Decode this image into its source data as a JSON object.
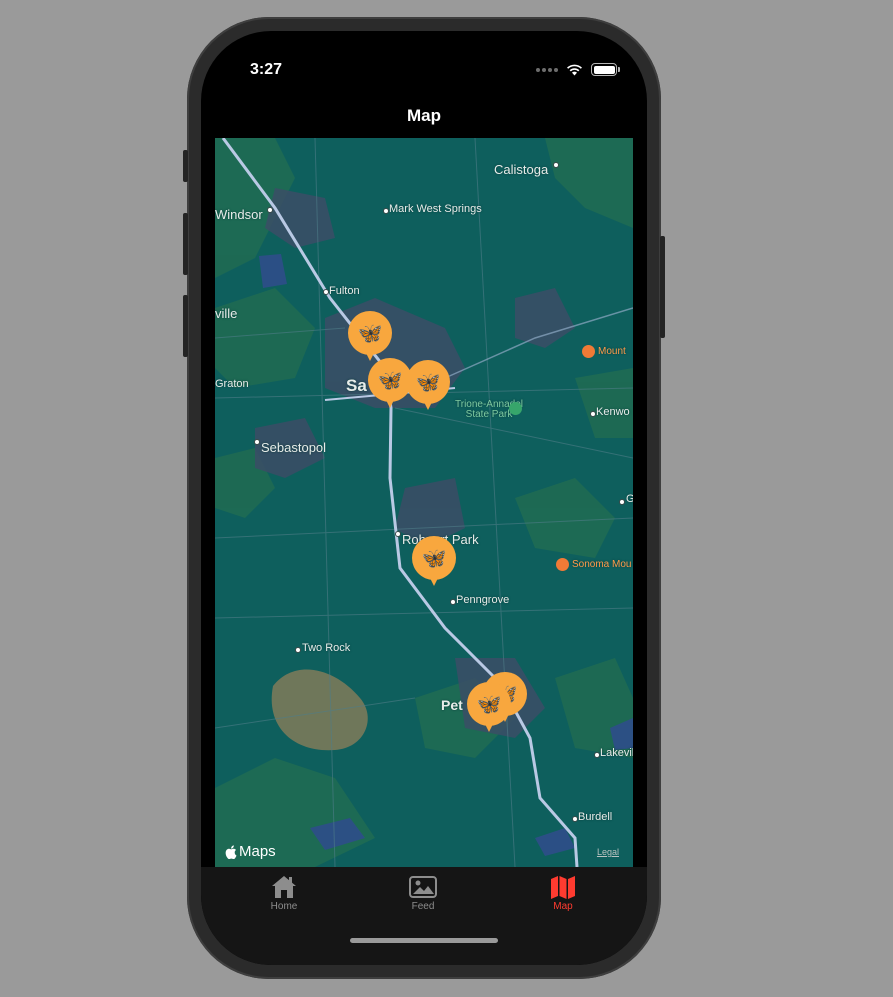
{
  "status_bar": {
    "time": "3:27"
  },
  "nav": {
    "title": "Map"
  },
  "map": {
    "labels": {
      "calistoga": "Calistoga",
      "windsor": "Windsor",
      "mark_west_springs": "Mark West Springs",
      "fulton": "Fulton",
      "graton": "Graton",
      "sebastopol": "Sebastopol",
      "santa_rosa_partial": "Sa",
      "trione_annadel": "Trione-Annadel\nState Park",
      "mount_partial": "Mount",
      "kenwood_partial": "Kenwo",
      "g_partial": "G",
      "rohnert_park": "Rohnert Park",
      "penngrove": "Penngrove",
      "sonoma_mountain_partial": "Sonoma Mou",
      "two_rock": "Two Rock",
      "petaluma_partial": "Pet",
      "lakeville": "Lakevil",
      "burdell": "Burdell",
      "ville_partial": "ville"
    },
    "pins": [
      {
        "icon": "butterfly-icon",
        "glyph": "🦋"
      },
      {
        "icon": "butterfly-icon",
        "glyph": "🦋"
      },
      {
        "icon": "butterfly-icon",
        "glyph": "🦋"
      },
      {
        "icon": "butterfly-icon",
        "glyph": "🦋"
      },
      {
        "icon": "butterfly-icon",
        "glyph": "🦋"
      },
      {
        "icon": "butterfly-icon",
        "glyph": "🦋"
      }
    ],
    "attribution": "Maps",
    "legal": "Legal"
  },
  "tabbar": {
    "items": [
      {
        "label": "Home",
        "icon": "house-icon"
      },
      {
        "label": "Feed",
        "icon": "photo-icon"
      },
      {
        "label": "Map",
        "icon": "map-icon",
        "active": true
      }
    ],
    "active_color": "#ff3b30"
  },
  "colors": {
    "pin": "#f8a73e",
    "map_base": "#0e5f5d"
  }
}
